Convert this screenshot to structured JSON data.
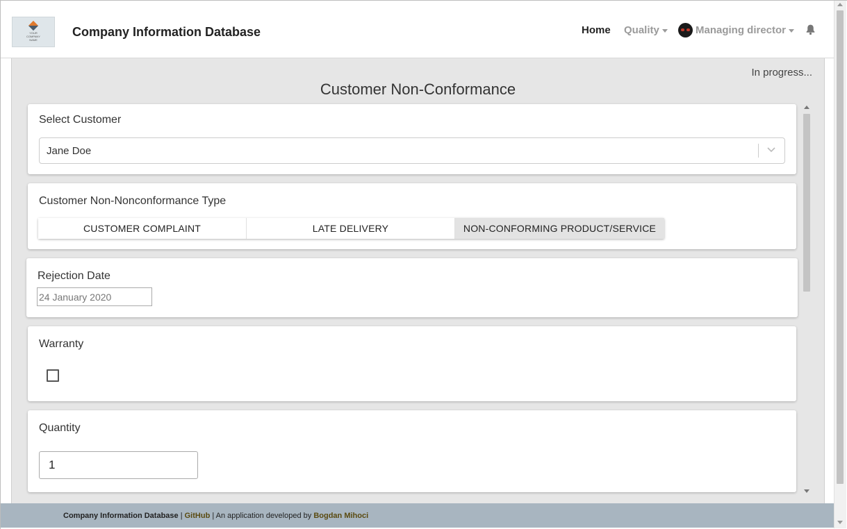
{
  "header": {
    "logo_lines": [
      "YOUR",
      "COMPANY",
      "NAME"
    ],
    "app_title": "Company Information Database",
    "nav": {
      "home": "Home",
      "quality": "Quality",
      "user": "Managing director"
    }
  },
  "main": {
    "status": "In progress...",
    "page_title": "Customer Non-Conformance",
    "select_customer": {
      "label": "Select Customer",
      "value": "Jane Doe"
    },
    "type": {
      "label": "Customer Non-Nonconformance Type",
      "options": [
        "CUSTOMER COMPLAINT",
        "LATE DELIVERY",
        "NON-CONFORMING PRODUCT/SERVICE"
      ],
      "selected": "NON-CONFORMING PRODUCT/SERVICE"
    },
    "rejection_date": {
      "label": "Rejection Date",
      "value": "24 January 2020"
    },
    "warranty": {
      "label": "Warranty",
      "checked": false
    },
    "quantity": {
      "label": "Quantity",
      "value": "1"
    }
  },
  "footer": {
    "app_name": "Company Information Database",
    "sep1": " | ",
    "github": "GitHub",
    "sep2": " | An application developed by ",
    "author": "Bogdan Mihoci"
  },
  "colors": {
    "panel_bg": "#e6e6e6",
    "footer_bg": "#a8b5c0",
    "segment_active": "#e3e3e3"
  }
}
